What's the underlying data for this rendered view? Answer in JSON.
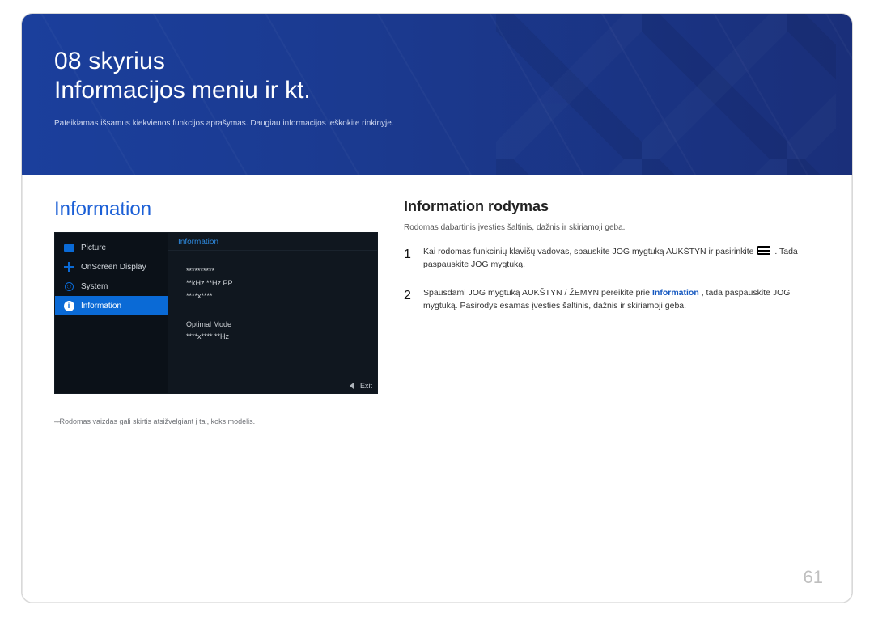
{
  "banner": {
    "chapter": "08 skyrius",
    "title": "Informacijos meniu ir kt.",
    "subtitle": "Pateikiamas išsamus kiekvienos funkcijos aprašymas. Daugiau informacijos ieškokite rinkinyje."
  },
  "left": {
    "heading": "Information",
    "osd": {
      "menu": {
        "picture": "Picture",
        "onscreen": "OnScreen Display",
        "system": "System",
        "information": "Information"
      },
      "panel_title": "Information",
      "line1": "**********",
      "line2": "**kHz **Hz PP",
      "line3": "****x****",
      "line4": "Optimal Mode",
      "line5": "****x**** **Hz",
      "exit": "Exit"
    },
    "footnote": "Rodomas vaizdas gali skirtis atsižvelgiant į tai, koks modelis."
  },
  "right": {
    "heading": "Information rodymas",
    "desc": "Rodomas dabartinis įvesties šaltinis, dažnis ir skiriamoji geba.",
    "steps": {
      "s1a": "Kai rodomas funkcinių klavišų vadovas, spauskite JOG mygtuką AUKŠTYN ir pasirinkite ",
      "s1b": ". Tada paspauskite JOG mygtuką.",
      "s2a": "Spausdami JOG mygtuką AUKŠTYN / ŽEMYN pereikite prie ",
      "s2hl": "Information",
      "s2b": ", tada paspauskite JOG mygtuką. Pasirodys esamas įvesties šaltinis, dažnis ir skiriamoji geba."
    }
  },
  "page_number": "61"
}
